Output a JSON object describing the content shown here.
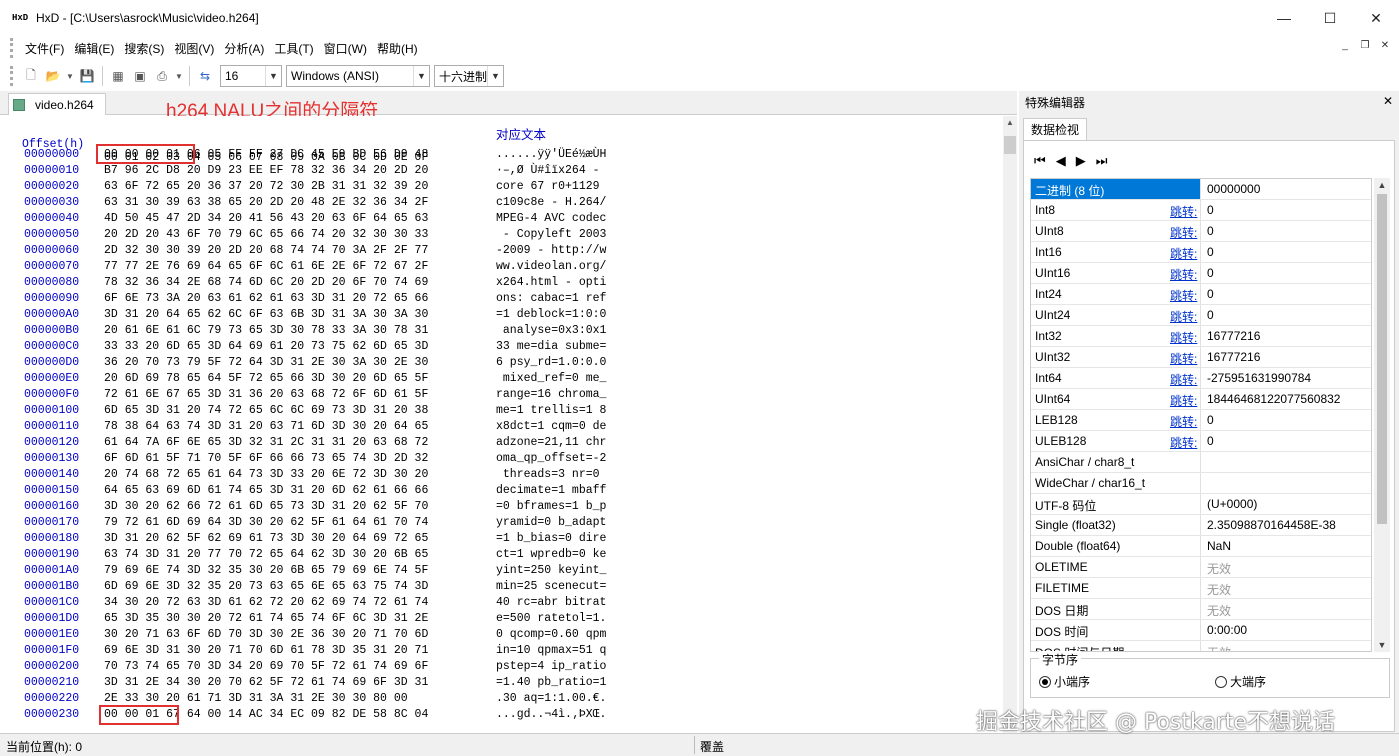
{
  "window": {
    "title": "HxD - [C:\\Users\\asrock\\Music\\video.h264]",
    "app_icon_text": "HxD",
    "minimize": "—",
    "maximize": "☐",
    "close": "✕"
  },
  "menu": [
    "文件(F)",
    "编辑(E)",
    "搜索(S)",
    "视图(V)",
    "分析(A)",
    "工具(T)",
    "窗口(W)",
    "帮助(H)"
  ],
  "toolbar": {
    "bytes_per_row": "16",
    "charset": "Windows (ANSI)",
    "offset_base": "十六进制"
  },
  "tab": {
    "label": "video.h264"
  },
  "annotation": "h264 NALU之间的分隔符",
  "hex": {
    "header_offset": "Offset(h)",
    "header_cols": "00 01 02 03 04 05 06 07 08 09 0A 0B 0C 0D 0E 0F",
    "header_text": "对应文本",
    "rows": [
      {
        "o": "00000000",
        "b": "00 00 00 01 06 05 FF FF 27 DC 45 E9 BD E6 D9 48",
        "t": "......ÿÿ'ÜEé½æÙH"
      },
      {
        "o": "00000010",
        "b": "B7 96 2C D8 20 D9 23 EE EF 78 32 36 34 20 2D 20",
        "t": "·–,Ø Ù#îïx264 - "
      },
      {
        "o": "00000020",
        "b": "63 6F 72 65 20 36 37 20 72 30 2B 31 31 32 39 20",
        "t": "core 67 r0+1129 "
      },
      {
        "o": "00000030",
        "b": "63 31 30 39 63 38 65 20 2D 20 48 2E 32 36 34 2F",
        "t": "c109c8e - H.264/"
      },
      {
        "o": "00000040",
        "b": "4D 50 45 47 2D 34 20 41 56 43 20 63 6F 64 65 63",
        "t": "MPEG-4 AVC codec"
      },
      {
        "o": "00000050",
        "b": "20 2D 20 43 6F 70 79 6C 65 66 74 20 32 30 30 33",
        "t": " - Copyleft 2003"
      },
      {
        "o": "00000060",
        "b": "2D 32 30 30 39 20 2D 20 68 74 74 70 3A 2F 2F 77",
        "t": "-2009 - http://w"
      },
      {
        "o": "00000070",
        "b": "77 77 2E 76 69 64 65 6F 6C 61 6E 2E 6F 72 67 2F",
        "t": "ww.videolan.org/"
      },
      {
        "o": "00000080",
        "b": "78 32 36 34 2E 68 74 6D 6C 20 2D 20 6F 70 74 69",
        "t": "x264.html - opti"
      },
      {
        "o": "00000090",
        "b": "6F 6E 73 3A 20 63 61 62 61 63 3D 31 20 72 65 66",
        "t": "ons: cabac=1 ref"
      },
      {
        "o": "000000A0",
        "b": "3D 31 20 64 65 62 6C 6F 63 6B 3D 31 3A 30 3A 30",
        "t": "=1 deblock=1:0:0"
      },
      {
        "o": "000000B0",
        "b": "20 61 6E 61 6C 79 73 65 3D 30 78 33 3A 30 78 31",
        "t": " analyse=0x3:0x1"
      },
      {
        "o": "000000C0",
        "b": "33 33 20 6D 65 3D 64 69 61 20 73 75 62 6D 65 3D",
        "t": "33 me=dia subme="
      },
      {
        "o": "000000D0",
        "b": "36 20 70 73 79 5F 72 64 3D 31 2E 30 3A 30 2E 30",
        "t": "6 psy_rd=1.0:0.0"
      },
      {
        "o": "000000E0",
        "b": "20 6D 69 78 65 64 5F 72 65 66 3D 30 20 6D 65 5F",
        "t": " mixed_ref=0 me_"
      },
      {
        "o": "000000F0",
        "b": "72 61 6E 67 65 3D 31 36 20 63 68 72 6F 6D 61 5F",
        "t": "range=16 chroma_"
      },
      {
        "o": "00000100",
        "b": "6D 65 3D 31 20 74 72 65 6C 6C 69 73 3D 31 20 38",
        "t": "me=1 trellis=1 8"
      },
      {
        "o": "00000110",
        "b": "78 38 64 63 74 3D 31 20 63 71 6D 3D 30 20 64 65",
        "t": "x8dct=1 cqm=0 de"
      },
      {
        "o": "00000120",
        "b": "61 64 7A 6F 6E 65 3D 32 31 2C 31 31 20 63 68 72",
        "t": "adzone=21,11 chr"
      },
      {
        "o": "00000130",
        "b": "6F 6D 61 5F 71 70 5F 6F 66 66 73 65 74 3D 2D 32",
        "t": "oma_qp_offset=-2"
      },
      {
        "o": "00000140",
        "b": "20 74 68 72 65 61 64 73 3D 33 20 6E 72 3D 30 20",
        "t": " threads=3 nr=0 "
      },
      {
        "o": "00000150",
        "b": "64 65 63 69 6D 61 74 65 3D 31 20 6D 62 61 66 66",
        "t": "decimate=1 mbaff"
      },
      {
        "o": "00000160",
        "b": "3D 30 20 62 66 72 61 6D 65 73 3D 31 20 62 5F 70",
        "t": "=0 bframes=1 b_p"
      },
      {
        "o": "00000170",
        "b": "79 72 61 6D 69 64 3D 30 20 62 5F 61 64 61 70 74",
        "t": "yramid=0 b_adapt"
      },
      {
        "o": "00000180",
        "b": "3D 31 20 62 5F 62 69 61 73 3D 30 20 64 69 72 65",
        "t": "=1 b_bias=0 dire"
      },
      {
        "o": "00000190",
        "b": "63 74 3D 31 20 77 70 72 65 64 62 3D 30 20 6B 65",
        "t": "ct=1 wpredb=0 ke"
      },
      {
        "o": "000001A0",
        "b": "79 69 6E 74 3D 32 35 30 20 6B 65 79 69 6E 74 5F",
        "t": "yint=250 keyint_"
      },
      {
        "o": "000001B0",
        "b": "6D 69 6E 3D 32 35 20 73 63 65 6E 65 63 75 74 3D",
        "t": "min=25 scenecut="
      },
      {
        "o": "000001C0",
        "b": "34 30 20 72 63 3D 61 62 72 20 62 69 74 72 61 74",
        "t": "40 rc=abr bitrat"
      },
      {
        "o": "000001D0",
        "b": "65 3D 35 30 30 20 72 61 74 65 74 6F 6C 3D 31 2E",
        "t": "e=500 ratetol=1."
      },
      {
        "o": "000001E0",
        "b": "30 20 71 63 6F 6D 70 3D 30 2E 36 30 20 71 70 6D",
        "t": "0 qcomp=0.60 qpm"
      },
      {
        "o": "000001F0",
        "b": "69 6E 3D 31 30 20 71 70 6D 61 78 3D 35 31 20 71",
        "t": "in=10 qpmax=51 q"
      },
      {
        "o": "00000200",
        "b": "70 73 74 65 70 3D 34 20 69 70 5F 72 61 74 69 6F",
        "t": "pstep=4 ip_ratio"
      },
      {
        "o": "00000210",
        "b": "3D 31 2E 34 30 20 70 62 5F 72 61 74 69 6F 3D 31",
        "t": "=1.40 pb_ratio=1"
      },
      {
        "o": "00000220",
        "b": "2E 33 30 20 61 71 3D 31 3A 31 2E 30 30 80 00",
        "t": ".30 aq=1:1.00.€."
      },
      {
        "o": "00000230",
        "b": "00 00 01 67 64 00 14 AC 34 EC 09 82 DE 58 8C 04",
        "t": "...gd..¬4ì.‚ÞXŒ."
      }
    ]
  },
  "panel": {
    "title": "特殊编辑器",
    "tab": "数据检视",
    "jump_label": "跳转:",
    "rows": [
      {
        "k": "二进制 (8 位)",
        "v": "00000000",
        "jump": false
      },
      {
        "k": "Int8",
        "v": "0",
        "jump": true
      },
      {
        "k": "UInt8",
        "v": "0",
        "jump": true
      },
      {
        "k": "Int16",
        "v": "0",
        "jump": true
      },
      {
        "k": "UInt16",
        "v": "0",
        "jump": true
      },
      {
        "k": "Int24",
        "v": "0",
        "jump": true
      },
      {
        "k": "UInt24",
        "v": "0",
        "jump": true
      },
      {
        "k": "Int32",
        "v": "16777216",
        "jump": true
      },
      {
        "k": "UInt32",
        "v": "16777216",
        "jump": true
      },
      {
        "k": "Int64",
        "v": "-275951631990784",
        "jump": true
      },
      {
        "k": "UInt64",
        "v": "18446468122077560832",
        "jump": true
      },
      {
        "k": "LEB128",
        "v": "0",
        "jump": true
      },
      {
        "k": "ULEB128",
        "v": "0",
        "jump": true
      },
      {
        "k": "AnsiChar / char8_t",
        "v": "",
        "jump": false
      },
      {
        "k": "WideChar / char16_t",
        "v": "",
        "jump": false
      },
      {
        "k": "UTF-8 码位",
        "v": "  (U+0000)",
        "jump": false
      },
      {
        "k": "Single (float32)",
        "v": "2.35098870164458E-38",
        "jump": false
      },
      {
        "k": "Double (float64)",
        "v": "NaN",
        "jump": false
      },
      {
        "k": "OLETIME",
        "v": "无效",
        "jump": false,
        "grey": true
      },
      {
        "k": "FILETIME",
        "v": "无效",
        "jump": false,
        "grey": true
      },
      {
        "k": "DOS 日期",
        "v": "无效",
        "jump": false,
        "grey": true
      },
      {
        "k": "DOS 时间",
        "v": "0:00:00",
        "jump": false
      },
      {
        "k": "DOS 时间与日期",
        "v": "无效",
        "jump": false,
        "grey": true
      }
    ],
    "byte_order_label": "字节序",
    "little_endian": "小端序",
    "big_endian": "大端序"
  },
  "status": {
    "position": "当前位置(h): 0",
    "mode": "覆盖"
  },
  "watermark": "掘金技术社区 @ Postkarte不想说话"
}
